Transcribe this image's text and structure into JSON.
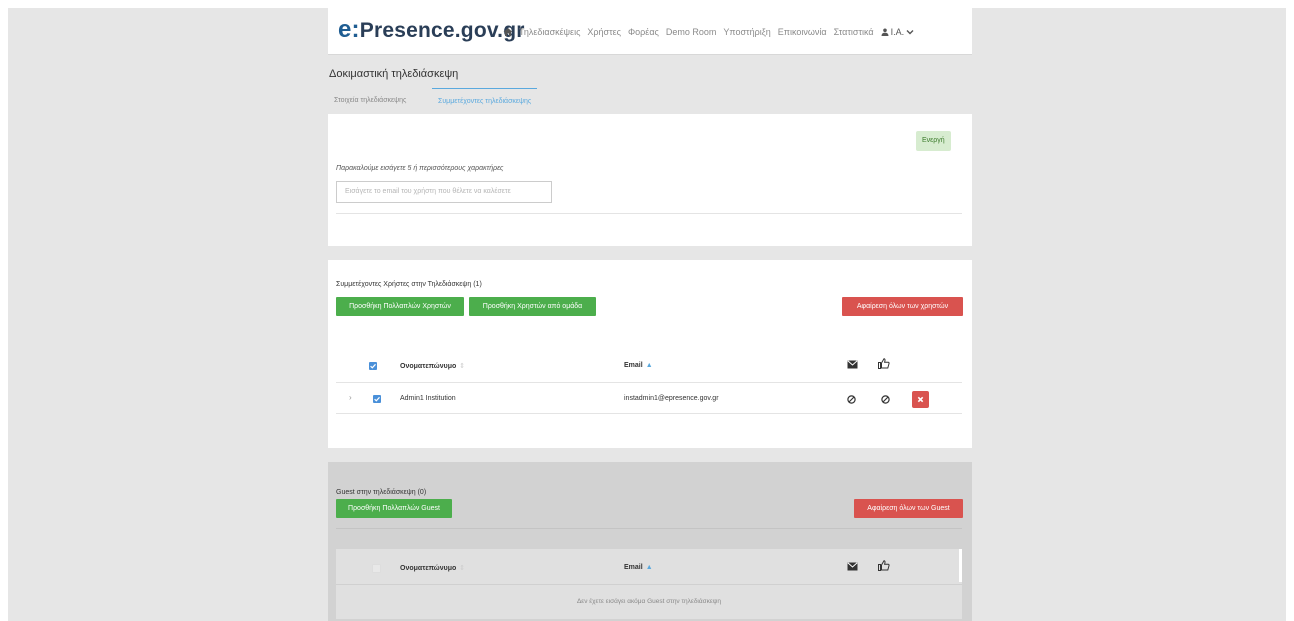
{
  "header": {
    "brand_prefix": "e:",
    "brand_name": "Presence.gov.gr",
    "nav": [
      "Τηλεδιασκέψεις",
      "Χρήστες",
      "Φορέας",
      "Demo Room",
      "Υποστήριξη",
      "Επικοινωνία",
      "Στατιστικά"
    ],
    "user_label": "I.A."
  },
  "conference": {
    "title": "Δοκιμαστική τηλεδιάσκεψη",
    "tabs": [
      "Στοιχεία τηλεδιάσκεψης",
      "Συμμετέχοντες τηλεδιάσκεψης"
    ]
  },
  "invite": {
    "status_badge": "Ενεργή",
    "hint": "Παρακαλούμε εισάγετε 5 ή περισσότερους χαρακτήρες",
    "placeholder": "Εισάγετε το email του χρήστη που θέλετε να καλέσετε"
  },
  "participants": {
    "heading": "Συμμετέχοντες Χρήστες στην Τηλεδιάσκεψη (1)",
    "add_multiple_label": "Προσθήκη Πολλαπλών Χρηστών",
    "add_group_label": "Προσθήκη Χρηστών από ομάδα",
    "remove_all_label": "Αφαίρεση όλων των χρηστών",
    "col_name": "Ονοματεπώνυμο",
    "col_email": "Email",
    "rows": [
      {
        "name": "Admin1 Institution",
        "email": "instadmin1@epresence.gov.gr"
      }
    ]
  },
  "guests": {
    "heading": "Guest στην τηλεδιάσκεψη (0)",
    "add_multiple_label": "Προσθήκη Πολλαπλών Guest",
    "remove_all_label": "Αφαίρεση όλων των Guest",
    "col_name": "Ονοματεπώνυμο",
    "col_email": "Email",
    "empty_message": "Δεν έχετε εισάγει ακόμα Guest στην τηλεδιάσκεψη"
  },
  "colors": {
    "accent_blue": "#5aa9de",
    "green": "#4cae4c",
    "red": "#d9534f",
    "active_badge_bg": "#d7ecd0"
  }
}
